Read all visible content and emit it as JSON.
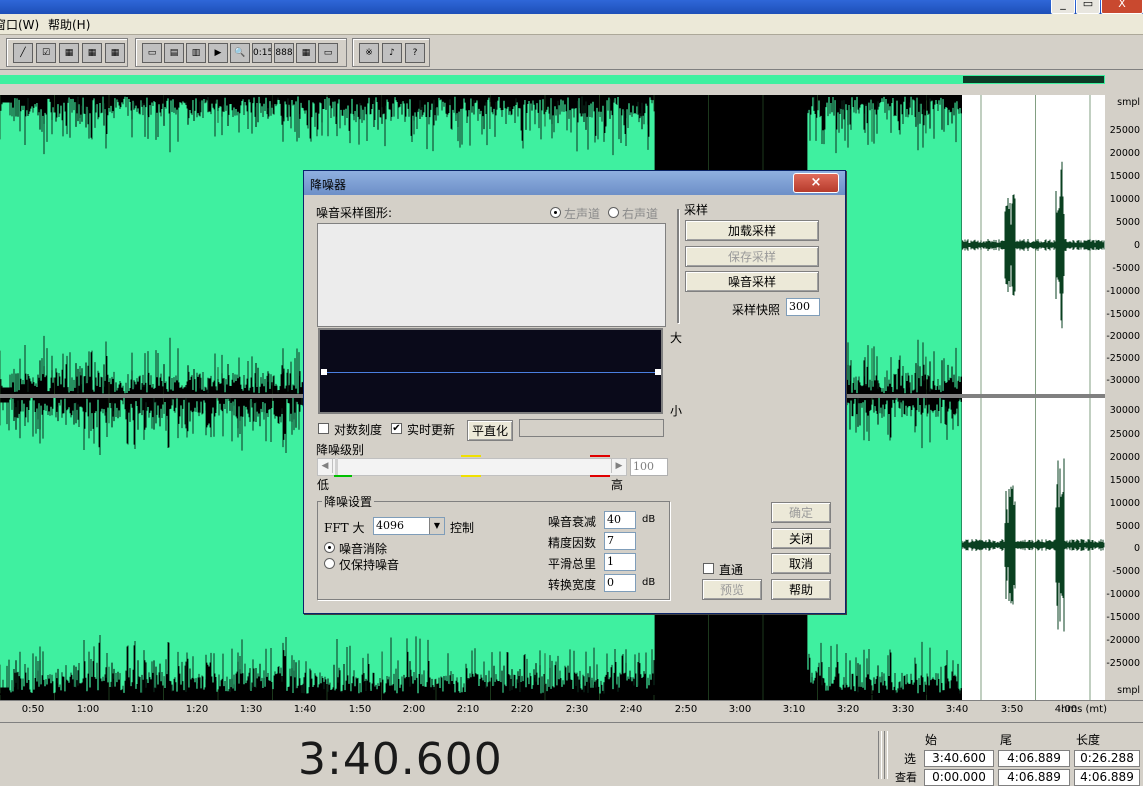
{
  "window": {
    "minimize": "_",
    "restore": "▭",
    "close": "X"
  },
  "menu": [
    {
      "label": "窗口(W)"
    },
    {
      "label": "帮助(H)"
    }
  ],
  "toolbar": {
    "group1": [
      "╱",
      "☑",
      "▦",
      "▦",
      "▦"
    ],
    "group2": [
      "▭",
      "▤",
      "▥",
      "▶",
      "🔍",
      "0:15",
      "888",
      "▦",
      "▭"
    ],
    "group3": [
      "※",
      "♪",
      "?"
    ]
  },
  "ruler_labels_top": [
    "smpl",
    "25000",
    "20000",
    "15000",
    "10000",
    "5000",
    "0",
    "-5000",
    "-10000",
    "-15000",
    "-20000",
    "-25000",
    "-30000"
  ],
  "ruler_labels_bottom": [
    "30000",
    "25000",
    "20000",
    "15000",
    "10000",
    "5000",
    "0",
    "-5000",
    "-10000",
    "-15000",
    "-20000",
    "-25000",
    "smpl"
  ],
  "time_labels": [
    "0:50",
    "1:00",
    "1:10",
    "1:20",
    "1:30",
    "1:40",
    "1:50",
    "2:00",
    "2:10",
    "2:20",
    "2:30",
    "2:40",
    "2:50",
    "3:00",
    "3:10",
    "3:20",
    "3:30",
    "3:40",
    "3:50",
    "4:00",
    "hms (mt)"
  ],
  "status": {
    "big_time": "3:40.600",
    "headers": {
      "start": "始",
      "end": "尾",
      "length": "长度"
    },
    "rows": [
      {
        "label": "选",
        "start": "3:40.600",
        "end": "4:06.889",
        "length": "0:26.288"
      },
      {
        "label": "查看",
        "start": "0:00.000",
        "end": "4:06.889",
        "length": "4:06.889"
      }
    ]
  },
  "dialog": {
    "title": "降噪器",
    "close": "×",
    "noise_profile_label": "噪音采样图形:",
    "left_channel": "左声道",
    "right_channel": "右声道",
    "graph_high": "大",
    "graph_low": "小",
    "log_scale": "对数刻度",
    "live_update": "实时更新",
    "flatten": "平直化",
    "reduction_level": "降噪级别",
    "level_low": "低",
    "level_high": "高",
    "level_value": "100",
    "sampling_group": "采样",
    "load_profile": "加载采样",
    "save_profile": "保存采样",
    "get_profile": "噪音采样",
    "snapshots_label": "采样快照",
    "snapshots_value": "300",
    "settings_group": "降噪设置",
    "fft_label": "FFT 大",
    "fft_value": "4096",
    "control_label": "控制",
    "remove_noise": "噪音消除",
    "keep_noise": "仅保持噪音",
    "attenuation_label": "噪音衰减",
    "attenuation_value": "40",
    "attenuation_unit": "dB",
    "precision_label": "精度因数",
    "precision_value": "7",
    "smoothing_label": "平滑总里",
    "smoothing_value": "1",
    "transition_label": "转换宽度",
    "transition_value": "0",
    "transition_unit": "dB",
    "bypass": "直通",
    "preview": "预览",
    "ok": "确定",
    "close_btn": "关闭",
    "cancel": "取消",
    "help": "帮助"
  },
  "colors": {
    "waveform": "#3ff0a0",
    "selection": "#ffffff",
    "graph_bg": "#0a0a1a",
    "graph_line": "#4a7fe0"
  }
}
